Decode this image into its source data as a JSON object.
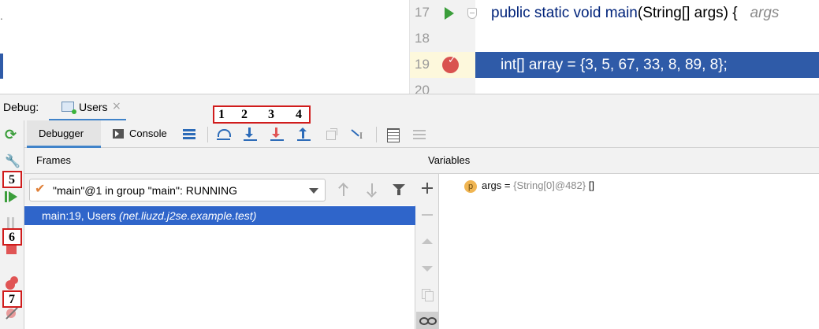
{
  "editor": {
    "lines": [
      {
        "number": "17",
        "code_keywords": "public static void ",
        "code_method": "main",
        "code_rest": "(String[] args) {",
        "hint": "args"
      },
      {
        "number": "18",
        "code": ""
      },
      {
        "number": "19",
        "code": "int[] array = {3, 5, 67, 33, 8, 89, 8};"
      },
      {
        "number": "20"
      }
    ]
  },
  "debug_window": {
    "label": "Debug:",
    "run_tab": {
      "label": "Users",
      "close": "×"
    }
  },
  "toolbar": {
    "debugger_tab": "Debugger",
    "console_tab": "Console"
  },
  "frames": {
    "title": "Frames",
    "thread_selected": "\"main\"@1 in group \"main\": RUNNING",
    "selected_frame": {
      "location": "main:19, Users",
      "package": "(net.liuzd.j2se.example.test)"
    }
  },
  "variables": {
    "title": "Variables",
    "items": [
      {
        "kind_badge": "p",
        "name": "args",
        "equals": " = ",
        "type": "{String[0]@482}",
        "value": "[]"
      }
    ]
  },
  "annotations": {
    "toolbar_numbers": [
      "1",
      "2",
      "3",
      "4"
    ],
    "side_numbers": [
      "5",
      "6",
      "7"
    ]
  },
  "colors": {
    "accent": "#4083c9",
    "selection": "#2f65ca",
    "code_highlight": "#2f5ba8",
    "callout_border": "#d01c1c"
  }
}
